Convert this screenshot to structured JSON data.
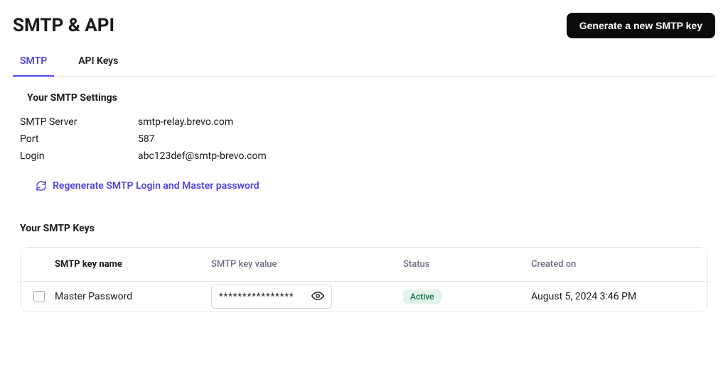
{
  "header": {
    "title": "SMTP & API",
    "new_key_button": "Generate a new SMTP key"
  },
  "tabs": [
    {
      "id": "smtp",
      "label": "SMTP",
      "active": true
    },
    {
      "id": "api-keys",
      "label": "API Keys",
      "active": false
    }
  ],
  "smtp_settings": {
    "heading": "Your SMTP Settings",
    "rows": [
      {
        "label": "SMTP Server",
        "value": "smtp-relay.brevo.com"
      },
      {
        "label": "Port",
        "value": "587"
      },
      {
        "label": "Login",
        "value": "abc123def@smtp-brevo.com"
      }
    ],
    "regenerate_link": "Regenerate SMTP Login and Master password"
  },
  "smtp_keys": {
    "heading": "Your SMTP Keys",
    "columns": {
      "name": "SMTP key name",
      "value": "SMTP key value",
      "status": "Status",
      "created": "Created on"
    },
    "rows": [
      {
        "name": "Master Password",
        "value_masked": "****************",
        "status": "Active",
        "created": "August 5, 2024 3:46 PM"
      }
    ]
  },
  "icons": {
    "refresh": "refresh-icon",
    "eye": "eye-icon"
  },
  "colors": {
    "accent": "#4f46e5",
    "badge_bg": "#e1f3ea",
    "badge_fg": "#116e44"
  }
}
